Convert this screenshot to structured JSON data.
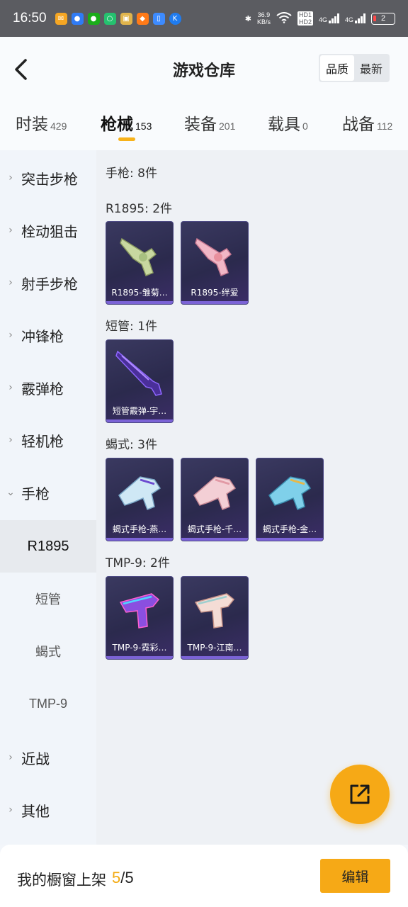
{
  "status_bar": {
    "time": "16:50",
    "net_speed_value": "36.9",
    "net_speed_unit": "KB/s",
    "hd1": "HD1",
    "hd2": "HD2",
    "sig1_label": "4G",
    "sig2_label": "4G",
    "battery_level": "2"
  },
  "header": {
    "title": "游戏仓库",
    "sort_options": [
      "品质",
      "最新"
    ],
    "sort_selected": "品质"
  },
  "tabs": [
    {
      "label": "时装",
      "count": "429"
    },
    {
      "label": "枪械",
      "count": "153"
    },
    {
      "label": "装备",
      "count": "201"
    },
    {
      "label": "载具",
      "count": "0"
    },
    {
      "label": "战备",
      "count": "112"
    }
  ],
  "active_tab": "枪械",
  "sidebar": {
    "categories": [
      "突击步枪",
      "栓动狙击",
      "射手步枪",
      "冲锋枪",
      "霰弹枪",
      "轻机枪",
      "手枪"
    ],
    "sub_items": [
      "R1895",
      "短管",
      "蝎式",
      "TMP-9"
    ],
    "active_sub": "R1895",
    "tail_categories": [
      "近战",
      "其他"
    ]
  },
  "content": {
    "total_title": "手枪: 8件",
    "groups": [
      {
        "title": "R1895: 2件",
        "items": [
          "R1895-雏菊…",
          "R1895-绊爱"
        ]
      },
      {
        "title": "短管: 1件",
        "items": [
          "短管霰弹-宇…"
        ]
      },
      {
        "title": "蝎式: 3件",
        "items": [
          "蝎式手枪-燕…",
          "蝎式手枪-千…",
          "蝎式手枪-金…"
        ]
      },
      {
        "title": "TMP-9: 2件",
        "items": [
          "TMP-9-霓彩…",
          "TMP-9-江南…"
        ]
      }
    ]
  },
  "bottom_bar": {
    "label": "我的橱窗上架",
    "current": "5",
    "total": "/5",
    "edit_label": "编辑"
  },
  "colors": {
    "accent": "#f6a916",
    "card_bg": "#2b2a4d",
    "status_bar": "#5b5c61"
  },
  "icons": {
    "back": "chevron-left-icon",
    "fab": "share-export-icon"
  }
}
